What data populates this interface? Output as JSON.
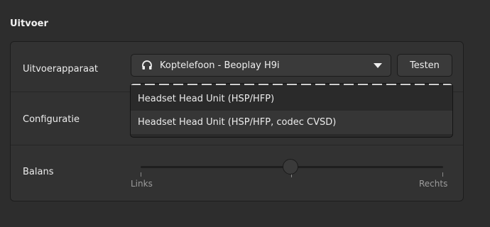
{
  "section": {
    "title": "Uitvoer"
  },
  "rows": {
    "device_label": "Uitvoerapparaat",
    "config_label": "Configuratie",
    "balance_label": "Balans"
  },
  "device_combo": {
    "icon": "headphones-icon",
    "selected": "Koptelefoon - Beoplay H9i"
  },
  "test_button": {
    "label": "Testen"
  },
  "config_popup": {
    "options": [
      "Headset Head Unit (HSP/HFP)",
      "Headset Head Unit (HSP/HFP, codec CVSD)"
    ],
    "hovered_index": 1
  },
  "balance": {
    "left_label": "Links",
    "right_label": "Rechts",
    "value": 0.5
  }
}
